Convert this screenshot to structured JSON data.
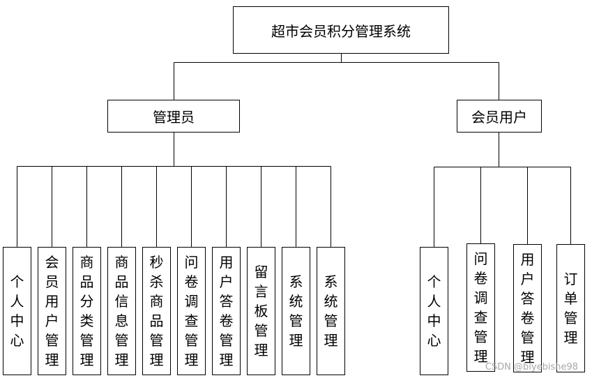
{
  "root": {
    "label": "超市会员积分管理系统"
  },
  "branches": [
    {
      "label": "管理员",
      "children": [
        "个人中心",
        "会员用户管理",
        "商品分类管理",
        "商品信息管理",
        "秒杀商品管理",
        "问卷调查管理",
        "用户答卷管理",
        "留言板管理",
        "系统管理",
        "系统管理"
      ]
    },
    {
      "label": "会员用户",
      "children": [
        "个人中心",
        "问卷调查管理",
        "用户答卷管理",
        "订单管理"
      ]
    }
  ],
  "watermark": "CSDN @biyebishe98"
}
